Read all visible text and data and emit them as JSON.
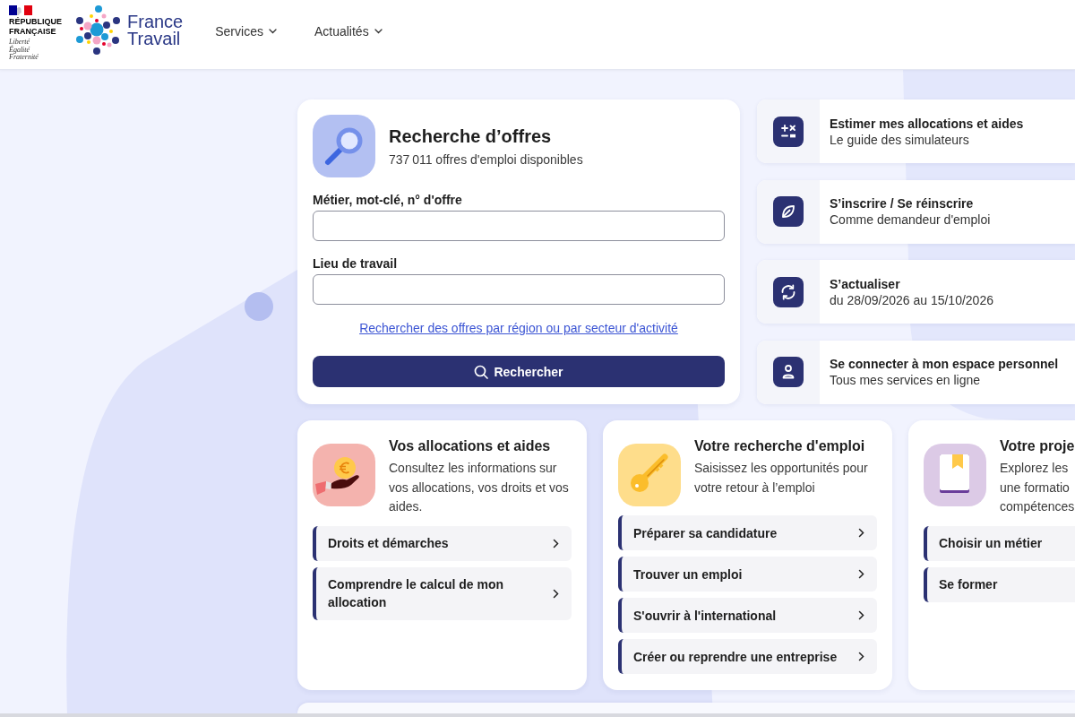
{
  "header": {
    "republic_name": "RÉPUBLIQUE FRANÇAISE",
    "motto": "Liberté Égalité Fraternité",
    "brand": "France Travail",
    "nav": [
      "Services",
      "Actualités"
    ]
  },
  "search": {
    "title": "Recherche d’offres",
    "subtitle": "737 011 offres d'emploi disponibles",
    "fields": [
      {
        "label": "Métier, mot-clé, n° d'offre"
      },
      {
        "label": "Lieu de travail"
      }
    ],
    "link": "Rechercher des offres par région ou par secteur d'activité",
    "button": "Rechercher"
  },
  "shortcuts": [
    {
      "kind": "calculator",
      "title": "Estimer mes allocations et aides",
      "subtitle": "Le guide des simulateurs"
    },
    {
      "kind": "register",
      "title": "S’inscrire / Se réinscrire",
      "subtitle": "Comme demandeur d'emploi"
    },
    {
      "kind": "update",
      "title": "S’actualiser",
      "subtitle": "du 28/09/2026 au 15/10/2026"
    },
    {
      "kind": "account",
      "title": "Se connecter à mon espace personnel",
      "subtitle": "Tous mes services en ligne"
    }
  ],
  "cards": [
    {
      "kind": "allowance",
      "clipped": false,
      "title": "Vos allocations et aides",
      "description": "Consultez les informations sur vos allocations, vos droits et vos aides.",
      "links": [
        "Droits et démarches",
        "Comprendre le calcul de mon allocation"
      ]
    },
    {
      "kind": "job",
      "clipped": false,
      "title": "Votre recherche d'emploi",
      "description": "Saisissez les opportunités pour votre retour à l’emploi",
      "links": [
        "Préparer sa candidature",
        "Trouver un emploi",
        "S'ouvrir à l'international",
        "Créer ou reprendre une entreprise"
      ]
    },
    {
      "kind": "project",
      "clipped": true,
      "title": "Votre proje",
      "description": "Explorez les\nune formatio\ncompétences",
      "links": [
        "Choisir un métier",
        "Se former"
      ]
    }
  ]
}
